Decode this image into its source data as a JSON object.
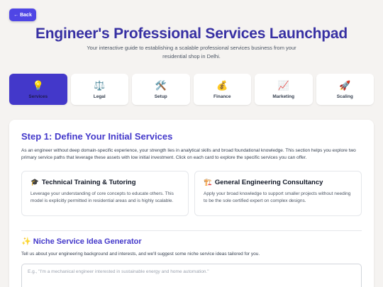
{
  "header": {
    "back_label": "← Back",
    "title": "Engineer's Professional Services Launchpad",
    "subtitle": "Your interactive guide to establishing a scalable professional services business from your residential shop in Delhi."
  },
  "tabs": [
    {
      "icon": "💡",
      "icon_name": "lightbulb-icon",
      "label": "Services",
      "active": true
    },
    {
      "icon": "⚖️",
      "icon_name": "scales-icon",
      "label": "Legal",
      "active": false
    },
    {
      "icon": "🛠️",
      "icon_name": "tools-icon",
      "label": "Setup",
      "active": false
    },
    {
      "icon": "💰",
      "icon_name": "money-bag-icon",
      "label": "Finance",
      "active": false
    },
    {
      "icon": "📈",
      "icon_name": "chart-up-icon",
      "label": "Marketing",
      "active": false
    },
    {
      "icon": "🚀",
      "icon_name": "rocket-icon",
      "label": "Scaling",
      "active": false
    }
  ],
  "section": {
    "title": "Step 1: Define Your Initial Services",
    "description": "As an engineer without deep domain-specific experience, your strength lies in analytical skills and broad foundational knowledge. This section helps you explore two primary service paths that leverage these assets with low initial investment. Click on each card to explore the specific services you can offer.",
    "cards": [
      {
        "icon": "🎓",
        "title": "Technical Training & Tutoring",
        "description": "Leverage your understanding of core concepts to educate others. This model is explicitly permitted in residential areas and is highly scalable."
      },
      {
        "icon": "🏗️",
        "title": "General Engineering Consultancy",
        "description": "Apply your broad knowledge to support smaller projects without needing to be the sole certified expert on complex designs."
      }
    ]
  },
  "generator": {
    "title": "✨ Niche Service Idea Generator",
    "description": "Tell us about your engineering background and interests, and we'll suggest some niche service ideas tailored for you.",
    "input_value": "",
    "placeholder": "E.g., \"I'm a mechanical engineer interested in sustainable energy and home automation.\""
  },
  "colors": {
    "accent": "#4338ca",
    "background": "#f5f3f1"
  }
}
